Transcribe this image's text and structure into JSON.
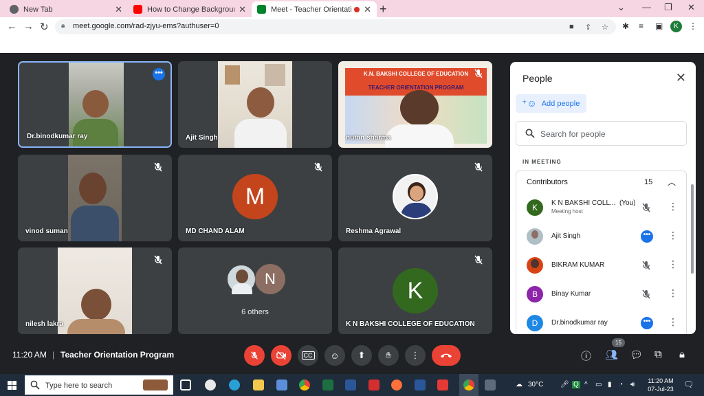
{
  "browser": {
    "tabs": [
      {
        "title": "New Tab",
        "favicon_color": "#5f6368",
        "active": false
      },
      {
        "title": "How to Change Background in G",
        "favicon_color": "#ff0000",
        "active": false
      },
      {
        "title": "Meet - Teacher Orientation P",
        "favicon_color": "#00832d",
        "active": true
      }
    ],
    "url": "meet.google.com/rad-zjyu-ems?authuser=0",
    "profile_initial": "K"
  },
  "tiles": [
    {
      "name": "Dr.binodkumar ray",
      "kind": "video",
      "selected": true,
      "more": true
    },
    {
      "name": "Ajit Singh",
      "kind": "video"
    },
    {
      "name": "nutan sharma",
      "kind": "video",
      "muted": true
    },
    {
      "name": "vinod suman",
      "kind": "video",
      "muted": true
    },
    {
      "name": "MD CHAND ALAM",
      "kind": "avatar",
      "initial": "M",
      "color": "#c4451c",
      "muted": true
    },
    {
      "name": "Reshma Agrawal",
      "kind": "photo",
      "muted": true
    },
    {
      "name": "nilesh lakra",
      "kind": "video",
      "muted": true
    },
    {
      "name": "6 others",
      "kind": "others",
      "initial": "N",
      "color": "#8d6e63"
    },
    {
      "name": "K N BAKSHI COLLEGE OF EDUCATION",
      "kind": "avatar",
      "initial": "K",
      "color": "#33691e",
      "muted": true
    }
  ],
  "banner": {
    "line1": "K.N. BAKSHI COLLEGE OF EDUCATION",
    "line2": "TEACHER ORIENTATION PROGRAM"
  },
  "people_panel": {
    "title": "People",
    "add_people_label": "Add people",
    "search_placeholder": "Search for people",
    "section_label": "IN MEETING",
    "contributors_label": "Contributors",
    "contributors_count": "15",
    "people": [
      {
        "name": "K N BAKSHI COLL...",
        "you": "(You)",
        "role": "Meeting host",
        "initial": "K",
        "color": "#33691e",
        "status": "muted"
      },
      {
        "name": "Ajit Singh",
        "role": "",
        "initial": "",
        "color": "#b0bec5",
        "status": "more"
      },
      {
        "name": "BIKRAM KUMAR",
        "role": "",
        "initial": "",
        "color": "#a1887f",
        "status": "muted"
      },
      {
        "name": "Binay Kumar",
        "role": "",
        "initial": "B",
        "color": "#8e24aa",
        "status": "muted"
      },
      {
        "name": "Dr.binodkumar ray",
        "role": "",
        "initial": "D",
        "color": "#1e88e5",
        "status": "more"
      }
    ]
  },
  "controls": {
    "time": "11:20 AM",
    "separator": "|",
    "meeting_title": "Teacher Orientation Program",
    "people_badge": "15"
  },
  "taskbar": {
    "search_placeholder": "Type here to search",
    "weather": "30°C",
    "clock_time": "11:20 AM",
    "clock_date": "07-Jul-23"
  }
}
